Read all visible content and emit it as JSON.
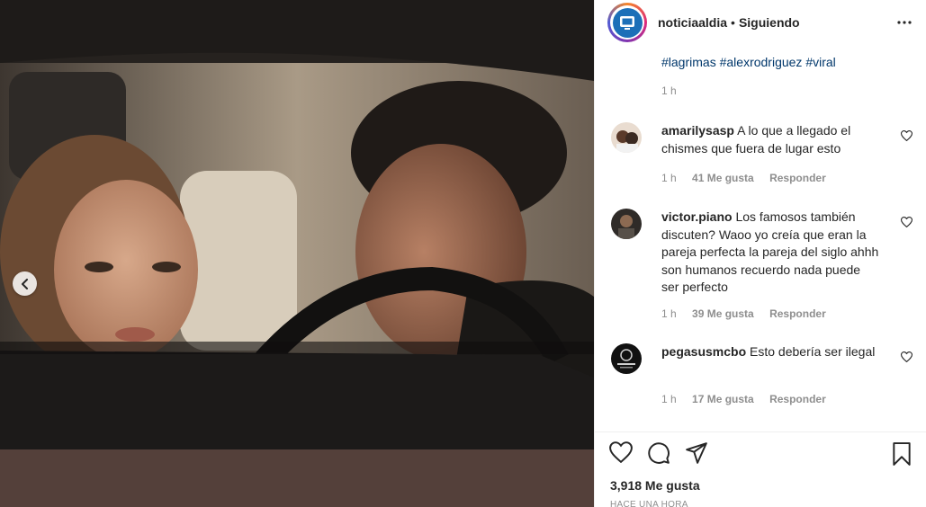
{
  "post": {
    "username": "noticiaaldia",
    "separator": "•",
    "follow_status": "Siguiendo",
    "hashtags": [
      "#lagrimas",
      "#alexrodriguez",
      "#viral"
    ],
    "caption_time": "1 h"
  },
  "comments": [
    {
      "user": "amarilysasp",
      "text": "A lo que a llegado el chismes que fuera de lugar esto",
      "time": "1 h",
      "likes": "41 Me gusta",
      "reply": "Responder"
    },
    {
      "user": "victor.piano",
      "text": "Los famosos también discuten? Waoo yo creía que eran la pareja perfecta la pareja del siglo ahhh son humanos recuerdo nada puede ser perfecto",
      "time": "1 h",
      "likes": "39 Me gusta",
      "reply": "Responder"
    },
    {
      "user": "pegasusmcbo",
      "text": "Esto debería ser ilegal",
      "time": "1 h",
      "likes": "17 Me gusta",
      "reply": "Responder"
    }
  ],
  "footer": {
    "likes_count": "3,918 Me gusta",
    "time_ago": "HACE UNA HORA"
  },
  "icons": {
    "more": "more-horizontal-icon",
    "like": "heart-icon",
    "comment": "comment-bubble-icon",
    "share": "paper-plane-icon",
    "save": "bookmark-icon",
    "prev": "chevron-left-icon"
  },
  "colors": {
    "hashtag": "#00376b",
    "meta": "#8e8e8e",
    "text": "#262626"
  }
}
